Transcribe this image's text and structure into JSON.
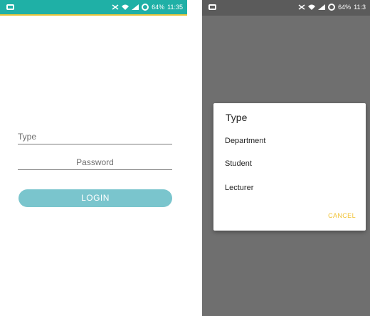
{
  "status_bar": {
    "left_icon": "app-notification-icon",
    "right_icons": [
      "mute-vibrate-icon",
      "wifi-icon",
      "signal-icon",
      "clock-icon"
    ],
    "battery": "64%",
    "time_left": "11:35",
    "time_right": "11:3"
  },
  "login_screen": {
    "type_field_placeholder": "Type",
    "password_field_placeholder": "Password",
    "login_button": "LOGIN",
    "colors": {
      "status_bar": "#1fb0a6",
      "button": "#7ac5cd",
      "accent_line": "#e7c43b"
    }
  },
  "type_dialog": {
    "title": "Type",
    "options": [
      {
        "label": "Department"
      },
      {
        "label": "Student"
      },
      {
        "label": "Lecturer"
      }
    ],
    "cancel_button": "CANCEL",
    "colors": {
      "overlay": "#6f6f6f",
      "cancel": "#f1c232"
    }
  }
}
